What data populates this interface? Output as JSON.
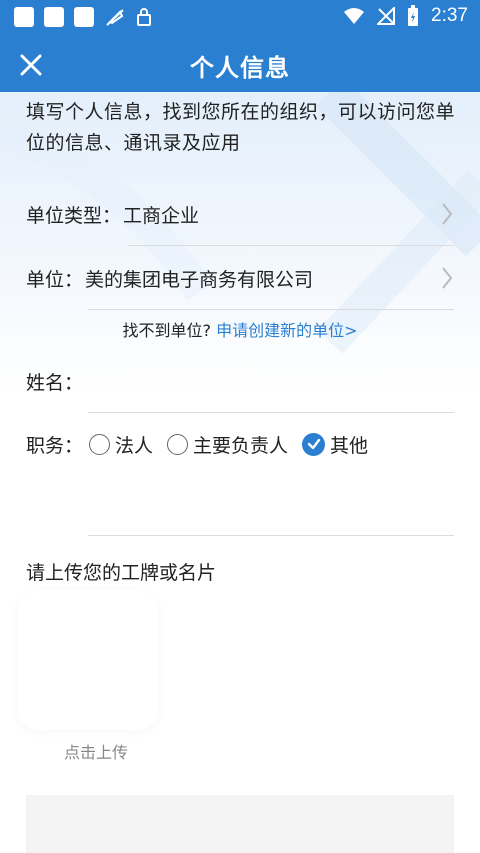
{
  "status_bar": {
    "time": "2:37"
  },
  "header": {
    "title": "个人信息",
    "close_icon": "close-icon"
  },
  "intro": "填写个人信息，找到您所在的组织，可以访问您单位的信息、通讯录及应用",
  "form": {
    "org_type": {
      "label": "单位类型：",
      "value": "工商企业"
    },
    "org": {
      "label": "单位：",
      "value": "美的集团电子商务有限公司"
    },
    "not_found": {
      "text": "找不到单位?",
      "link": "申请创建新的单位>"
    },
    "name": {
      "label": "姓名：",
      "value": ""
    },
    "position": {
      "label": "职务：",
      "options": [
        {
          "label": "法人",
          "checked": false
        },
        {
          "label": "主要负责人",
          "checked": false
        },
        {
          "label": "其他",
          "checked": true
        }
      ]
    }
  },
  "upload": {
    "title": "请上传您的工牌或名片",
    "button_label": "点击上传"
  },
  "colors": {
    "primary": "#2a7fd1",
    "link": "#2a7fd1"
  }
}
